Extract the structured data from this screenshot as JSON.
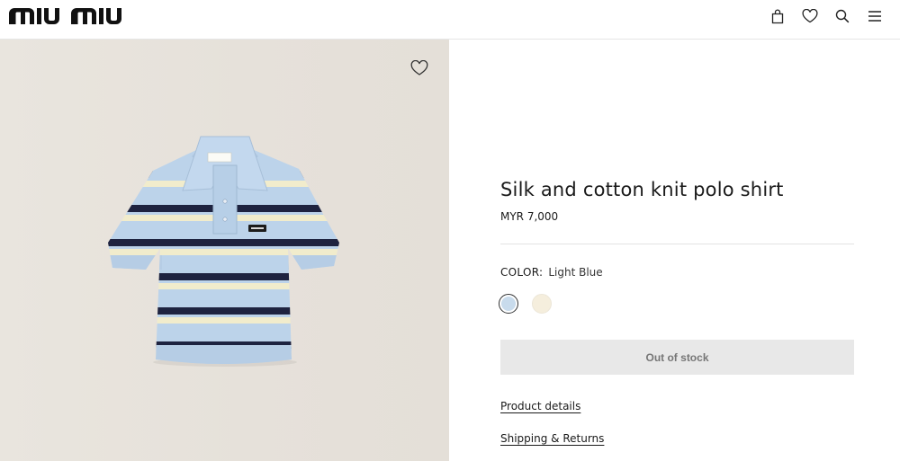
{
  "header": {
    "brand": "MIU MIU",
    "icons": [
      "bag-icon",
      "heart-icon",
      "search-icon",
      "menu-icon"
    ]
  },
  "product": {
    "title": "Silk and cotton knit polo shirt",
    "price": "MYR 7,000",
    "color_label": "COLOR:",
    "color_value": "Light Blue",
    "swatches": [
      {
        "name": "Light Blue",
        "hex": "#c8dbec",
        "selected": true
      },
      {
        "name": "Cream",
        "hex": "#f5eedd",
        "selected": false
      }
    ],
    "stock_button": "Out of stock",
    "links": {
      "details": "Product details",
      "shipping": "Shipping & Returns"
    },
    "label_patch": "MIU MIU"
  },
  "colors": {
    "image_bg": "#e8e4dd",
    "button_bg": "#e8e8e8",
    "shirt_blue": "#bcd3ea",
    "stripe_navy": "#1e2340",
    "stripe_cream": "#f1eccc"
  }
}
